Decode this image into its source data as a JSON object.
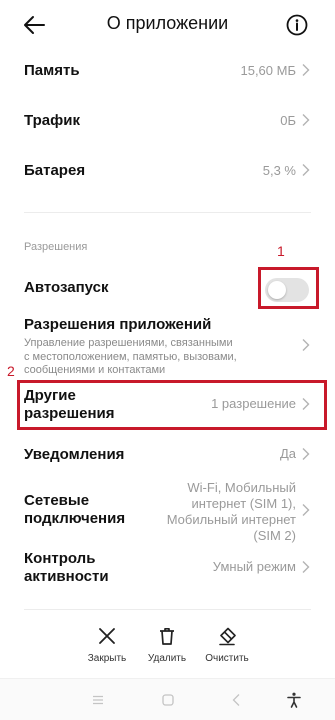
{
  "app_bar": {
    "title": "О приложении"
  },
  "rows": {
    "memory": {
      "title": "Память",
      "value": "15,60 МБ"
    },
    "traffic": {
      "title": "Трафик",
      "value": "0Б"
    },
    "battery": {
      "title": "Батарея",
      "value": "5,3 %"
    }
  },
  "permissions_section": {
    "label": "Разрешения",
    "autostart": {
      "title": "Автозапуск",
      "enabled": false
    },
    "app_permissions": {
      "title": "Разрешения приложений",
      "subtitle_lines": [
        "Управление разрешениями, связанными",
        "с местоположением, памятью, вызовами,",
        "сообщениями и контактами"
      ]
    },
    "other_permissions": {
      "title_lines": [
        "Другие",
        "разрешения"
      ],
      "value": "1 разрешение"
    },
    "notifications": {
      "title": "Уведомления",
      "value": "Да"
    },
    "network": {
      "title_lines": [
        "Сетевые",
        "подключения"
      ],
      "value_lines": [
        "Wi-Fi, Мобильный",
        "интернет (SIM 1),",
        "Мобильный интернет",
        "(SIM 2)"
      ]
    },
    "activity": {
      "title_lines": [
        "Контроль",
        "активности"
      ],
      "value": "Умный режим"
    }
  },
  "annotations": {
    "label_1": "1",
    "label_2": "2",
    "color": "#c8192a"
  },
  "actions": {
    "close": {
      "label": "Закрыть",
      "icon": "close-icon"
    },
    "delete": {
      "label": "Удалить",
      "icon": "trash-icon"
    },
    "clear": {
      "label": "Очистить",
      "icon": "eraser-icon"
    }
  }
}
